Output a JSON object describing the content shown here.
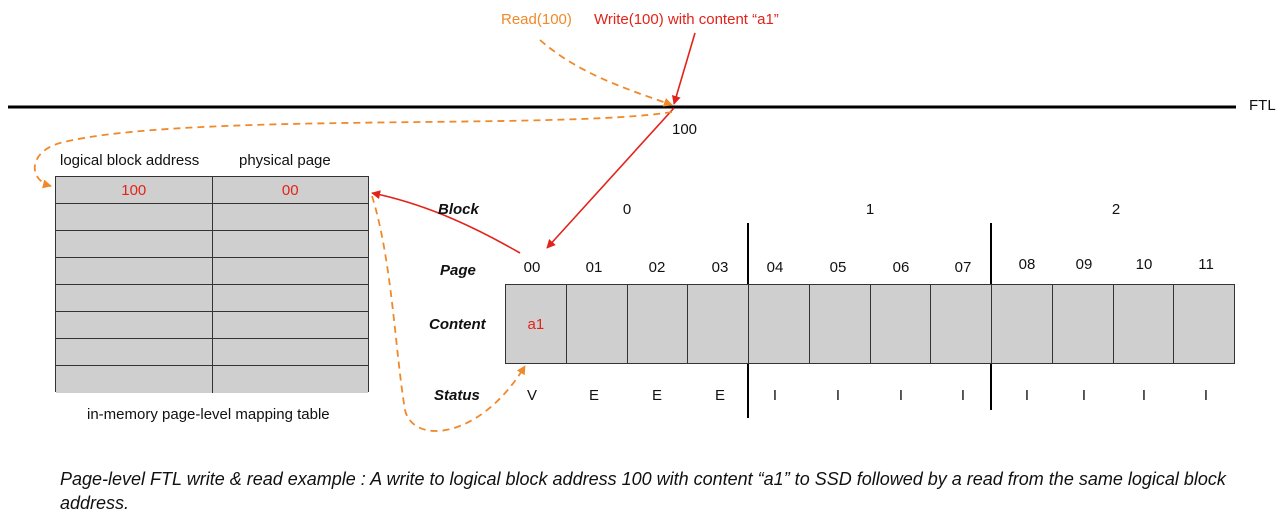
{
  "ops": {
    "read": "Read(100)",
    "write": "Write(100) with content “a1”"
  },
  "ftl_label": "FTL",
  "address_label": "100",
  "mapping_table": {
    "headers": [
      "logical block address",
      "physical page"
    ],
    "rows": [
      [
        "100",
        "00"
      ],
      [
        "",
        ""
      ],
      [
        "",
        ""
      ],
      [
        "",
        ""
      ],
      [
        "",
        ""
      ],
      [
        "",
        ""
      ],
      [
        "",
        ""
      ],
      [
        "",
        ""
      ]
    ],
    "caption": "in-memory page-level mapping table"
  },
  "flash": {
    "row_labels": {
      "block": "Block",
      "page": "Page",
      "content": "Content",
      "status": "Status"
    },
    "blocks": [
      "0",
      "1",
      "2"
    ],
    "pages": [
      "00",
      "01",
      "02",
      "03",
      "04",
      "05",
      "06",
      "07",
      "08",
      "09",
      "10",
      "11"
    ],
    "contents": [
      "a1",
      "",
      "",
      "",
      "",
      "",
      "",
      "",
      "",
      "",
      "",
      ""
    ],
    "statuses": [
      "V",
      "E",
      "E",
      "E",
      "I",
      "I",
      "I",
      "I",
      "I",
      "I",
      "I",
      "I"
    ]
  },
  "colors": {
    "write_path": "#e2231a",
    "read_path": "#f0892a",
    "cell_fill": "#cfcfcf"
  },
  "caption": "Page-level FTL write & read example : A write to logical block address 100 with content “a1” to SSD followed by a read from the same logical block address."
}
